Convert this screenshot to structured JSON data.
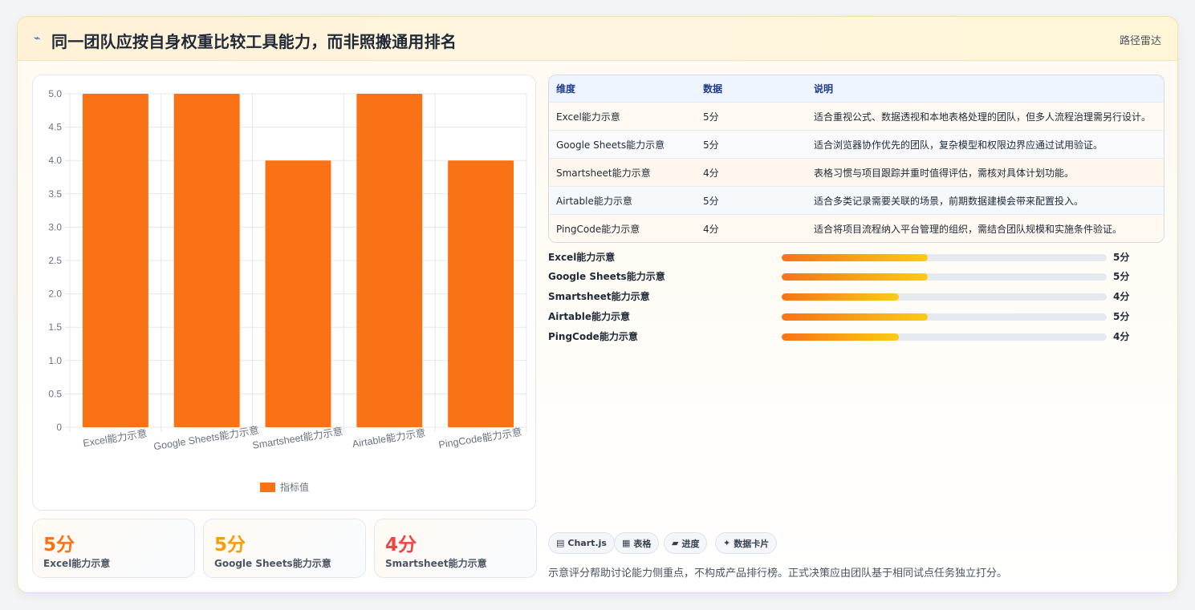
{
  "header": {
    "title": "同一团队应按自身权重比较工具能力，而非照搬通用排名",
    "tag": "路径雷达"
  },
  "chart_data": {
    "type": "bar",
    "categories": [
      "Excel能力示意",
      "Google Sheets能力示意",
      "Smartsheet能力示意",
      "Airtable能力示意",
      "PingCode能力示意"
    ],
    "series": [
      {
        "name": "指标值",
        "values": [
          5,
          5,
          4,
          5,
          4
        ]
      }
    ],
    "ylim": [
      0,
      5
    ],
    "yticks": [
      "0",
      "0.5",
      "1.0",
      "1.5",
      "2.0",
      "2.5",
      "3.0",
      "3.5",
      "4.0",
      "4.5",
      "5.0"
    ],
    "legend": "bottom",
    "grid": true,
    "color": "#f97316"
  },
  "stats": [
    {
      "value": "5分",
      "label": "Excel能力示意",
      "color": "#f97316"
    },
    {
      "value": "5分",
      "label": "Google Sheets能力示意",
      "color": "#f59e0b"
    },
    {
      "value": "4分",
      "label": "Smartsheet能力示意",
      "color": "#ef4444"
    }
  ],
  "table": {
    "headers": [
      "维度",
      "数据",
      "说明"
    ],
    "rows": [
      [
        "Excel能力示意",
        "5分",
        "适合重视公式、数据透视和本地表格处理的团队，但多人流程治理需另行设计。"
      ],
      [
        "Google Sheets能力示意",
        "5分",
        "适合浏览器协作优先的团队，复杂模型和权限边界应通过试用验证。"
      ],
      [
        "Smartsheet能力示意",
        "4分",
        "表格习惯与项目跟踪并重时值得评估，需核对具体计划功能。"
      ],
      [
        "Airtable能力示意",
        "5分",
        "适合多类记录需要关联的场景，前期数据建模会带来配置投入。"
      ],
      [
        "PingCode能力示意",
        "4分",
        "适合将项目流程纳入平台管理的组织，需结合团队规模和实施条件验证。"
      ]
    ]
  },
  "progress": [
    {
      "label": "Excel能力示意",
      "value": "5分",
      "fraction": 0.45
    },
    {
      "label": "Google Sheets能力示意",
      "value": "5分",
      "fraction": 0.45
    },
    {
      "label": "Smartsheet能力示意",
      "value": "4分",
      "fraction": 0.36
    },
    {
      "label": "Airtable能力示意",
      "value": "5分",
      "fraction": 0.45
    },
    {
      "label": "PingCode能力示意",
      "value": "4分",
      "fraction": 0.36
    }
  ],
  "chips": [
    {
      "icon": "chart-icon",
      "glyph": "▤",
      "label": "Chart.js"
    },
    {
      "icon": "table-icon",
      "glyph": "▦",
      "label": "表格"
    },
    {
      "icon": "progress-icon",
      "glyph": "▰",
      "label": "进度"
    },
    {
      "icon": "card-icon",
      "glyph": "✦",
      "label": "数据卡片"
    }
  ],
  "note": "示意评分帮助讨论能力侧重点，不构成产品排行榜。正式决策应由团队基于相同试点任务独立打分。"
}
